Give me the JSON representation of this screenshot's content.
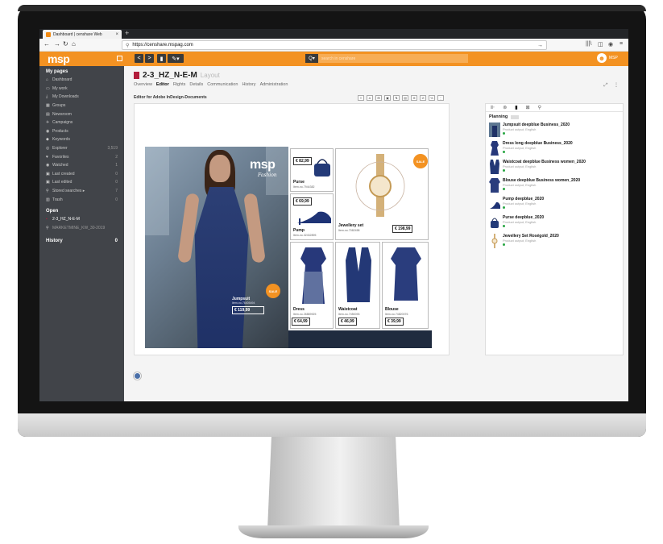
{
  "browser": {
    "tab_title": "Dashboard | censhare Web",
    "tab_close": "×",
    "new_tab": "+",
    "url": "https://censhare.mspag.com",
    "back": "←",
    "forward": "→",
    "reload": "↻",
    "home": "⌂",
    "go": "→",
    "library_icon": "|||\\",
    "sidebar_icon": "◫",
    "account_icon": "◉",
    "menu_icon": "≡"
  },
  "header": {
    "logo": "msp",
    "search_placeholder": "search in censhare",
    "search_scope": "Q▾",
    "user_label": "MSP",
    "back_btn": "<",
    "fwd_btn": ">",
    "doc_btn": "▮",
    "edit_btn": "✎▾"
  },
  "sidebar": {
    "section_title": "My pages",
    "items": [
      {
        "icon": "⌂",
        "label": "Dashboard",
        "count": ""
      },
      {
        "icon": "▭",
        "label": "My work",
        "count": ""
      },
      {
        "icon": "⤓",
        "label": "My Downloads",
        "count": ""
      },
      {
        "icon": "▦",
        "label": "Groups",
        "count": ""
      },
      {
        "icon": "▤",
        "label": "Newsroom",
        "count": ""
      },
      {
        "icon": "✈",
        "label": "Campaigns",
        "count": ""
      },
      {
        "icon": "◉",
        "label": "Products",
        "count": ""
      },
      {
        "icon": "◆",
        "label": "Keywords",
        "count": ""
      },
      {
        "icon": "◎",
        "label": "Explorer",
        "count": "3,519"
      },
      {
        "icon": "♥",
        "label": "Favorites",
        "count": "2"
      },
      {
        "icon": "◉",
        "label": "Watched",
        "count": "1"
      },
      {
        "icon": "▣",
        "label": "Last created",
        "count": "0"
      },
      {
        "icon": "▣",
        "label": "Last edited",
        "count": "0"
      },
      {
        "icon": "⚲",
        "label": "Stored searches ▸",
        "count": "7"
      },
      {
        "icon": "▥",
        "label": "Trash",
        "count": "0"
      }
    ],
    "open_title": "Open",
    "open_items": [
      {
        "icon": "▪",
        "label": "2-3_HZ_N-E-M"
      },
      {
        "icon": "⚲",
        "label": "MARKETMINE_KW_30-2019"
      }
    ],
    "history_title": "History",
    "history_count": "0"
  },
  "document": {
    "name": "2-3_HZ_N-E-M",
    "type": "Layout",
    "tabs": [
      "Overview",
      "Editor",
      "Rights",
      "Details",
      "Communication",
      "History",
      "Administration"
    ],
    "active_tab": "Editor",
    "editor_title": "Editor for Adobe InDesign-Documents",
    "tools": [
      "≡",
      "A",
      "⊞",
      "▣",
      "⇅",
      "▤",
      "⊕",
      "⊘",
      "%",
      "⋮"
    ],
    "expand_icon": "⤢",
    "more_icon": "⋮"
  },
  "layout": {
    "brand": "msp",
    "brand_sub": "Fashion",
    "sale": "SALE",
    "jumpsuit": {
      "name": "Jumpsuit",
      "item": "Item-no.76405494",
      "price": "€ 119,99"
    },
    "purse": {
      "name": "Purse",
      "item": "Item-no.7944382",
      "price": "€ 82,99"
    },
    "pump": {
      "name": "Pump",
      "item": "Item-no.32432895",
      "price": "€ 69,99"
    },
    "jewellery": {
      "name": "Jewellery set",
      "item": "Item-no.7082458",
      "price": "€ 198,99"
    },
    "dress": {
      "name": "Dress",
      "item": "Item-no.26889925",
      "price": "€ 64,99"
    },
    "waistcoat": {
      "name": "Waistcoat",
      "item": "Item-no.7450093",
      "price": "€ 46,99"
    },
    "blouse": {
      "name": "Blouse",
      "item": "Item-no.74820076",
      "price": "€ 39,99"
    }
  },
  "right_panel": {
    "tabs": [
      "⊪",
      "⊚",
      "▮",
      "⊠",
      "⚲"
    ],
    "active_tab": 2,
    "planning_title": "Planning",
    "items": [
      {
        "title": "Jumpsuit deepblue Business_2020",
        "sub": "Product output, English"
      },
      {
        "title": "Dress long deepblue Business_2020",
        "sub": "Product output, English"
      },
      {
        "title": "Waistcoat deepblue Business women_2020",
        "sub": "Product output, English"
      },
      {
        "title": "Blouse deepblue Business women_2020",
        "sub": "Product output, English"
      },
      {
        "title": "Pump deepblue_2020",
        "sub": "Product output, English"
      },
      {
        "title": "Purse deepblue_2020",
        "sub": "Product output, English"
      },
      {
        "title": "Jewellery Set Roségold_2020",
        "sub": "Product output, English"
      }
    ]
  },
  "colors": {
    "accent": "#f39222",
    "sidebar": "#414449",
    "navy": "#1f3166"
  }
}
